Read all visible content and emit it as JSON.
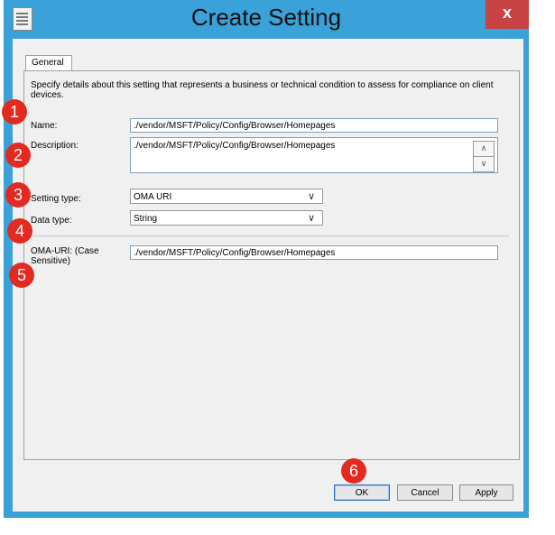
{
  "window": {
    "title": "Create Setting",
    "close_glyph": "x"
  },
  "tabs": [
    {
      "label": "General"
    }
  ],
  "intro_text": "Specify details about this setting that represents a business or technical condition to assess for compliance on client devices.",
  "form": {
    "name": {
      "label": "Name:",
      "value": "./vendor/MSFT/Policy/Config/Browser/Homepages"
    },
    "description": {
      "label": "Description:",
      "value": "./vendor/MSFT/Policy/Config/Browser/Homepages"
    },
    "setting_type": {
      "label": "Setting type:",
      "value": "OMA URI"
    },
    "data_type": {
      "label": "Data type:",
      "value": "String"
    },
    "oma_uri": {
      "label": "OMA-URI: (Case Sensitive)",
      "value": "./vendor/MSFT/Policy/Config/Browser/Homepages"
    }
  },
  "buttons": {
    "ok": "OK",
    "cancel": "Cancel",
    "apply": "Apply"
  },
  "markers": [
    "1",
    "2",
    "3",
    "4",
    "5",
    "6"
  ],
  "colors": {
    "frame": "#3ba1d9",
    "close": "#c74343",
    "marker": "#e32a21"
  }
}
